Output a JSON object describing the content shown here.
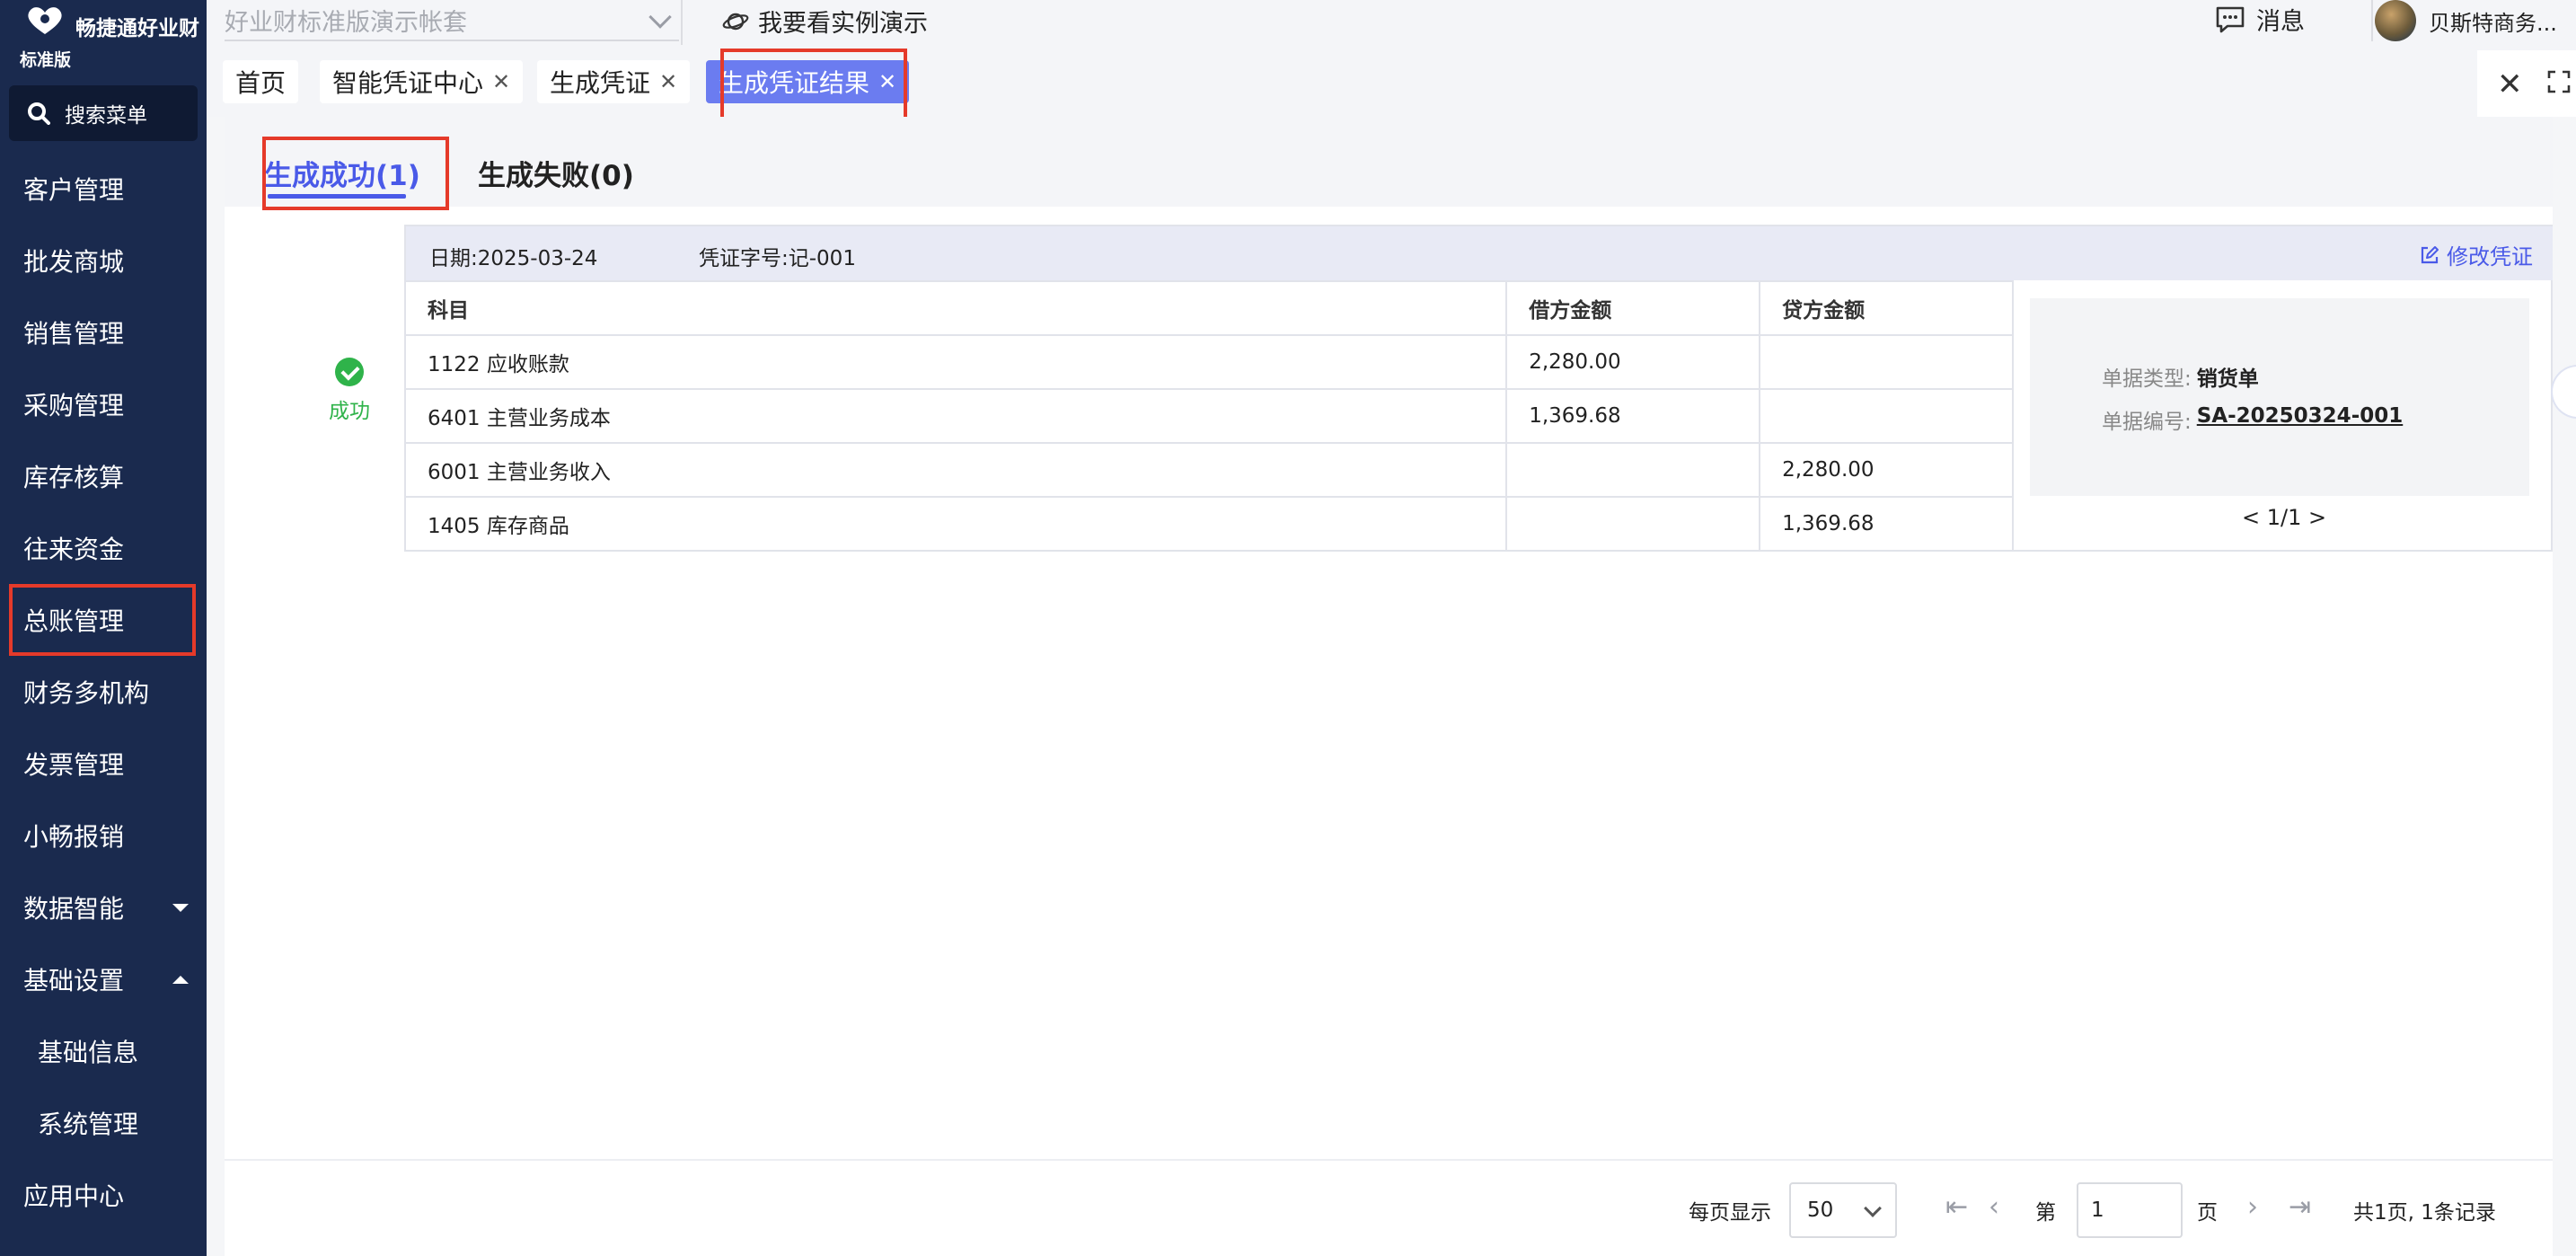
{
  "app": {
    "logo_text": "畅捷通好业财",
    "edition": "标准版"
  },
  "sidebar": {
    "search_label": "搜索菜单",
    "items": [
      {
        "label": "客户管理"
      },
      {
        "label": "批发商城"
      },
      {
        "label": "销售管理"
      },
      {
        "label": "采购管理"
      },
      {
        "label": "库存核算"
      },
      {
        "label": "往来资金"
      },
      {
        "label": "总账管理"
      },
      {
        "label": "财务多机构"
      },
      {
        "label": "发票管理"
      },
      {
        "label": "小畅报销"
      },
      {
        "label": "数据智能"
      },
      {
        "label": "基础设置"
      },
      {
        "label": "基础信息"
      },
      {
        "label": "系统管理"
      },
      {
        "label": "应用中心"
      }
    ]
  },
  "topbar": {
    "account_placeholder": "好业财标准版演示帐套",
    "demo_link": "我要看实例演示",
    "messages": "消息",
    "user_name": "贝斯特商务..."
  },
  "tabs": [
    {
      "label": "首页"
    },
    {
      "label": "智能凭证中心"
    },
    {
      "label": "生成凭证"
    },
    {
      "label": "生成凭证结果"
    }
  ],
  "result_tabs": {
    "success": "生成成功(1)",
    "failed": "生成失败(0)"
  },
  "voucher": {
    "status": "成功",
    "date_label": "日期:",
    "date_value": "2025-03-24",
    "no_label": "凭证字号:",
    "no_value": "记-001",
    "edit_label": "修改凭证",
    "columns": [
      "科目",
      "借方金额",
      "贷方金额"
    ],
    "rows": [
      {
        "account": "1122 应收账款",
        "debit": "2,280.00",
        "credit": ""
      },
      {
        "account": "6401 主营业务成本",
        "debit": "1,369.68",
        "credit": ""
      },
      {
        "account": "6001 主营业务收入",
        "debit": "",
        "credit": "2,280.00"
      },
      {
        "account": "1405 库存商品",
        "debit": "",
        "credit": "1,369.68"
      }
    ],
    "doc_type_label": "单据类型:",
    "doc_type_value": "销货单",
    "doc_no_label": "单据编号:",
    "doc_no_value": "SA-20250324-001",
    "doc_pager": "< 1/1 >"
  },
  "pagination": {
    "per_page_label": "每页显示",
    "per_page_value": "50",
    "page_prefix": "第",
    "page_value": "1",
    "page_suffix": "页",
    "summary": "共1页, 1条记录"
  },
  "colors": {
    "sidebar_bg": "#1a2a4e",
    "accent": "#4a5ae8",
    "active_tab": "#6b7cf0",
    "success": "#2fb34a",
    "highlight_box": "#e53a2a"
  }
}
